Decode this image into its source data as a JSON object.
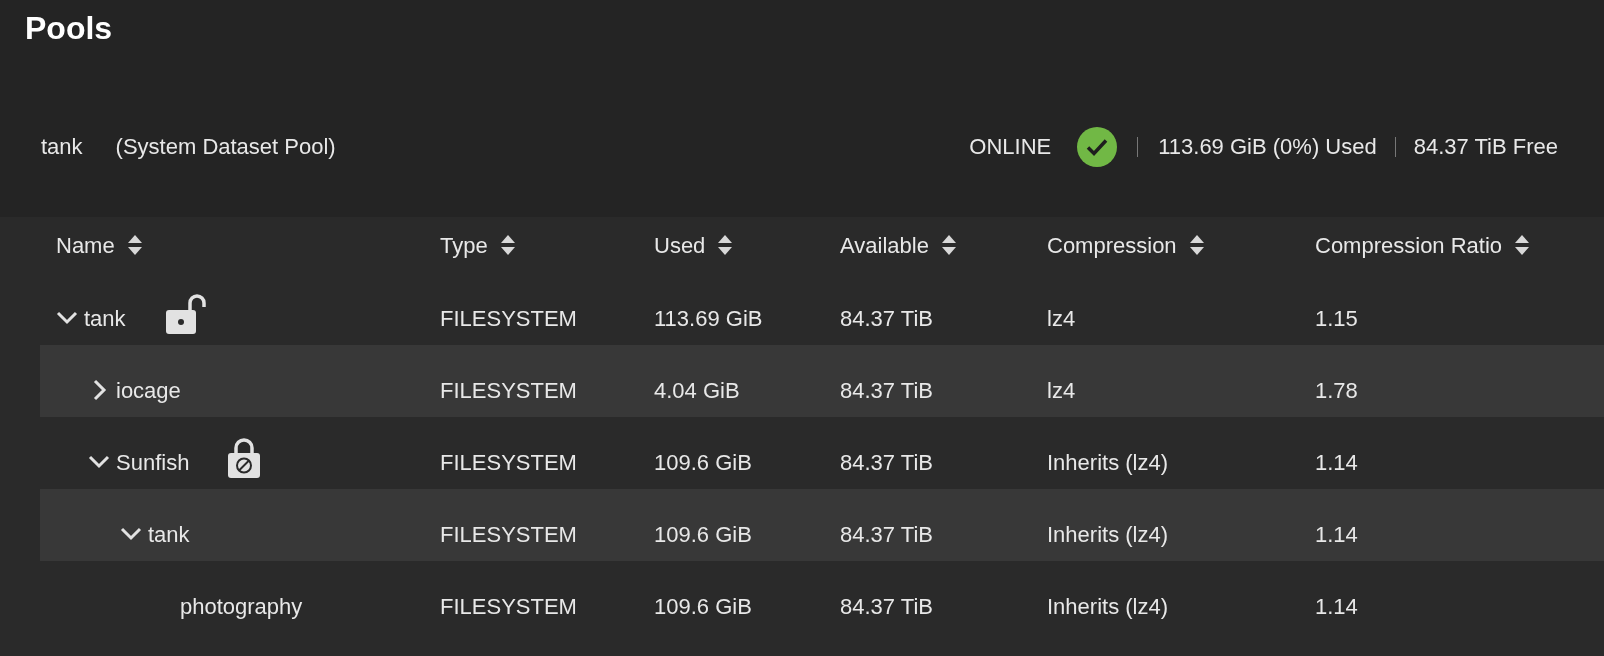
{
  "page_title": "Pools",
  "pool": {
    "name": "tank",
    "note": "(System Dataset Pool)",
    "status": "ONLINE",
    "healthy": true,
    "used": "113.69 GiB (0%) Used",
    "free": "84.37 TiB Free"
  },
  "table": {
    "columns": [
      "Name",
      "Type",
      "Used",
      "Available",
      "Compression",
      "Compression Ratio"
    ],
    "rows": [
      {
        "name": "tank",
        "encryption": {
          "locked": false
        },
        "expanded": true,
        "type": "FILESYSTEM",
        "used": "113.69 GiB",
        "available": "84.37 TiB",
        "compression": "lz4",
        "ratio": "1.15",
        "children": [
          {
            "name": "iocage",
            "expanded": false,
            "type": "FILESYSTEM",
            "used": "4.04 GiB",
            "available": "84.37 TiB",
            "compression": "lz4",
            "ratio": "1.78"
          },
          {
            "name": "Sunfish",
            "encryption": {
              "locked": true
            },
            "expanded": true,
            "type": "FILESYSTEM",
            "used": "109.6 GiB",
            "available": "84.37 TiB",
            "compression": "Inherits (lz4)",
            "ratio": "1.14",
            "children": [
              {
                "name": "tank",
                "expanded": true,
                "type": "FILESYSTEM",
                "used": "109.6 GiB",
                "available": "84.37 TiB",
                "compression": "Inherits (lz4)",
                "ratio": "1.14",
                "children": [
                  {
                    "name": "photography",
                    "type": "FILESYSTEM",
                    "used": "109.6 GiB",
                    "available": "84.37 TiB",
                    "compression": "Inherits (lz4)",
                    "ratio": "1.14"
                  }
                ]
              }
            ]
          }
        ]
      }
    ]
  }
}
